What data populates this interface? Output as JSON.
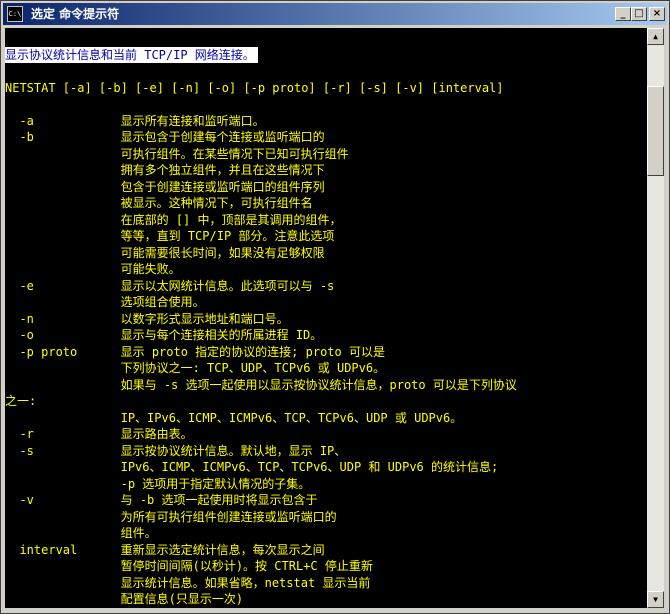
{
  "window": {
    "title": "选定 命令提示符",
    "icon": "C:\\",
    "controls": {
      "minimize": "_",
      "maximize": "□",
      "close": "×"
    }
  },
  "console": {
    "colors": {
      "background": "#000000",
      "text": "#ffff00",
      "selection_bg": "#ffffff",
      "selection_text": "#0000a8"
    },
    "lines": [
      "显示协议统计信息和当前 TCP/IP 网络连接。",
      "",
      "NETSTAT [-a] [-b] [-e] [-n] [-o] [-p proto] [-r] [-s] [-v] [interval]",
      "",
      "  -a            显示所有连接和监听端口。",
      "  -b            显示包含于创建每个连接或监听端口的",
      "                可执行组件。在某些情况下已知可执行组件",
      "                拥有多个独立组件，并且在这些情况下",
      "                包含于创建连接或监听端口的组件序列",
      "                被显示。这种情况下，可执行组件名",
      "                在底部的 [] 中，顶部是其调用的组件，",
      "                等等，直到 TCP/IP 部分。注意此选项",
      "                可能需要很长时间，如果没有足够权限",
      "                可能失败。",
      "  -e            显示以太网统计信息。此选项可以与 -s",
      "                选项组合使用。",
      "  -n            以数字形式显示地址和端口号。",
      "  -o            显示与每个连接相关的所属进程 ID。",
      "  -p proto      显示 proto 指定的协议的连接; proto 可以是",
      "                下列协议之一: TCP、UDP、TCPv6 或 UDPv6。",
      "                如果与 -s 选项一起使用以显示按协议统计信息，proto 可以是下列协议",
      "之一:",
      "                IP、IPv6、ICMP、ICMPv6、TCP、TCPv6、UDP 或 UDPv6。",
      "  -r            显示路由表。",
      "  -s            显示按协议统计信息。默认地，显示 IP、",
      "                IPv6、ICMP、ICMPv6、TCP、TCPv6、UDP 和 UDPv6 的统计信息;",
      "                -p 选项用于指定默认情况的子集。",
      "  -v            与 -b 选项一起使用时将显示包含于",
      "                为所有可执行组件创建连接或监听端口的",
      "                组件。",
      "  interval      重新显示选定统计信息，每次显示之间",
      "                暂停时间间隔(以秒计)。按 CTRL+C 停止重新",
      "                显示统计信息。如果省略，netstat 显示当前",
      "                配置信息(只显示一次)"
    ]
  },
  "scrollbar": {
    "up": "▲",
    "down": "▼"
  }
}
